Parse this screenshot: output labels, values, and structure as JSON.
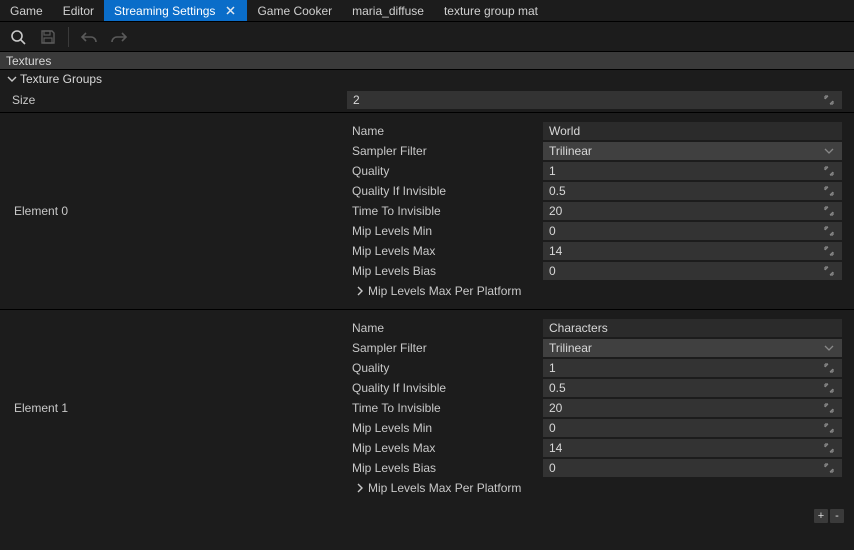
{
  "tabs": [
    {
      "label": "Game"
    },
    {
      "label": "Editor"
    },
    {
      "label": "Streaming Settings",
      "active": true,
      "closeable": true
    },
    {
      "label": "Game Cooker"
    },
    {
      "label": "maria_diffuse"
    },
    {
      "label": "texture group mat"
    }
  ],
  "section": {
    "title": "Textures"
  },
  "tree": {
    "root_label": "Texture Groups"
  },
  "props": {
    "size_label": "Size",
    "size_value": "2"
  },
  "elements": [
    {
      "label": "Element 0",
      "rows": [
        {
          "label": "Name",
          "value": "World",
          "type": "text"
        },
        {
          "label": "Sampler Filter",
          "value": "Trilinear",
          "type": "select"
        },
        {
          "label": "Quality",
          "value": "1",
          "type": "num"
        },
        {
          "label": "Quality If Invisible",
          "value": "0.5",
          "type": "num"
        },
        {
          "label": "Time To Invisible",
          "value": "20",
          "type": "num"
        },
        {
          "label": "Mip Levels Min",
          "value": "0",
          "type": "num"
        },
        {
          "label": "Mip Levels Max",
          "value": "14",
          "type": "num"
        },
        {
          "label": "Mip Levels Bias",
          "value": "0",
          "type": "num"
        },
        {
          "label": "Mip Levels Max Per Platform",
          "type": "expander"
        }
      ]
    },
    {
      "label": "Element 1",
      "rows": [
        {
          "label": "Name",
          "value": "Characters",
          "type": "text"
        },
        {
          "label": "Sampler Filter",
          "value": "Trilinear",
          "type": "select"
        },
        {
          "label": "Quality",
          "value": "1",
          "type": "num"
        },
        {
          "label": "Quality If Invisible",
          "value": "0.5",
          "type": "num"
        },
        {
          "label": "Time To Invisible",
          "value": "20",
          "type": "num"
        },
        {
          "label": "Mip Levels Min",
          "value": "0",
          "type": "num"
        },
        {
          "label": "Mip Levels Max",
          "value": "14",
          "type": "num"
        },
        {
          "label": "Mip Levels Bias",
          "value": "0",
          "type": "num"
        },
        {
          "label": "Mip Levels Max Per Platform",
          "type": "expander"
        }
      ]
    }
  ],
  "footer": {
    "add": "+",
    "remove": "-"
  }
}
